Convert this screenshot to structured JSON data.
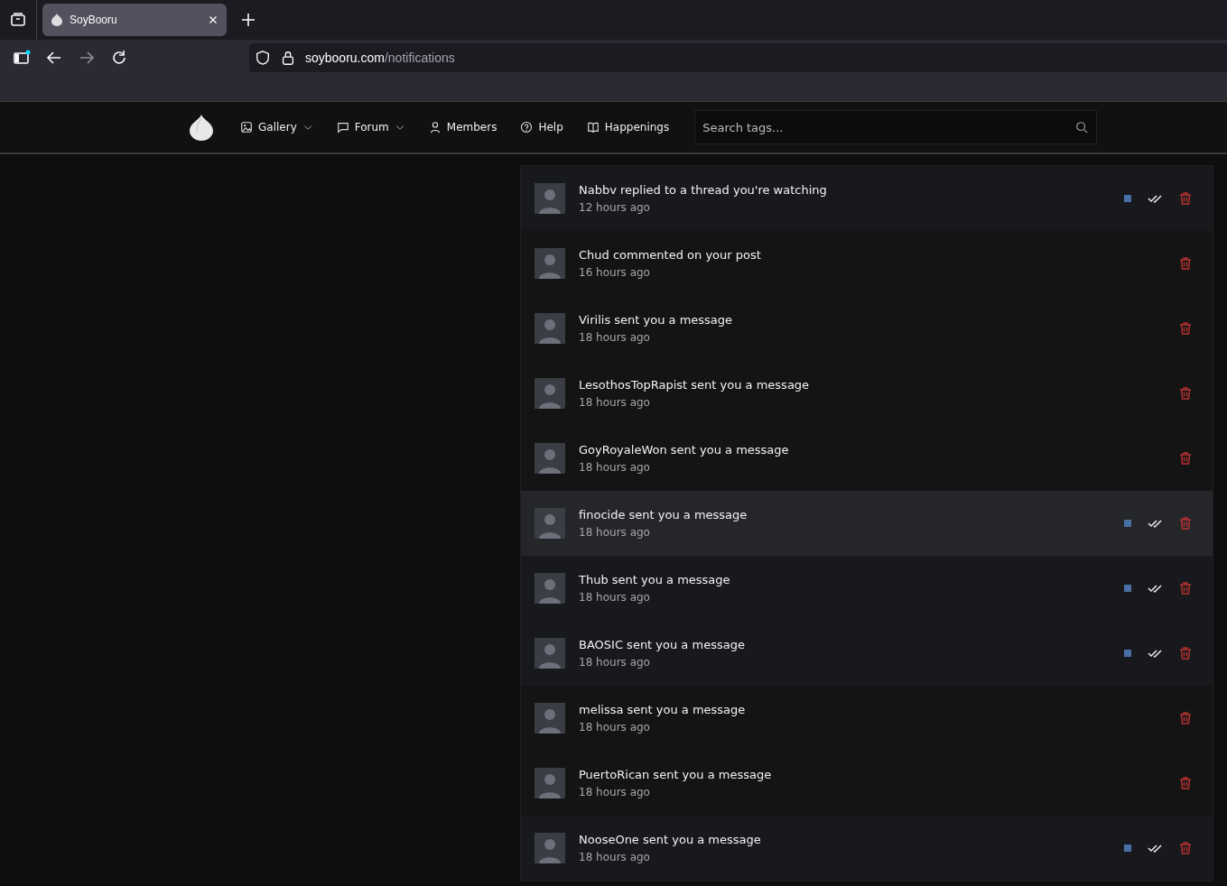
{
  "browser": {
    "tabs": [
      {
        "title": "SoyBooru",
        "selected": true
      }
    ],
    "url_host": "soybooru.com",
    "url_path": "/notifications"
  },
  "nav": {
    "items": [
      {
        "label": "Gallery",
        "kind": "gallery",
        "dropdown": true
      },
      {
        "label": "Forum",
        "kind": "forum",
        "dropdown": true
      },
      {
        "label": "Members",
        "kind": "members",
        "dropdown": false
      },
      {
        "label": "Help",
        "kind": "help",
        "dropdown": false
      },
      {
        "label": "Happenings",
        "kind": "happenings",
        "dropdown": false
      }
    ],
    "search": {
      "placeholder": "Search tags..."
    }
  },
  "notifications": [
    {
      "text": "Nabbv replied to a thread you're watching",
      "time": "12 hours ago",
      "unread": true,
      "hovered": false
    },
    {
      "text": "Chud commented on your post",
      "time": "16 hours ago",
      "unread": false,
      "hovered": false
    },
    {
      "text": "Virilis sent you a message",
      "time": "18 hours ago",
      "unread": false,
      "hovered": false
    },
    {
      "text": "LesothosTopRapist sent you a message",
      "time": "18 hours ago",
      "unread": false,
      "hovered": false
    },
    {
      "text": "GoyRoyaleWon sent you a message",
      "time": "18 hours ago",
      "unread": false,
      "hovered": false
    },
    {
      "text": "finocide sent you a message",
      "time": "18 hours ago",
      "unread": true,
      "hovered": true
    },
    {
      "text": "Thub sent you a message",
      "time": "18 hours ago",
      "unread": true,
      "hovered": false
    },
    {
      "text": "BAOSIC sent you a message",
      "time": "18 hours ago",
      "unread": true,
      "hovered": false
    },
    {
      "text": "melissa sent you a message",
      "time": "18 hours ago",
      "unread": false,
      "hovered": false
    },
    {
      "text": "PuertoRican sent you a message",
      "time": "18 hours ago",
      "unread": false,
      "hovered": false
    },
    {
      "text": "NooseOne sent you a message",
      "time": "18 hours ago",
      "unread": true,
      "hovered": false
    }
  ]
}
